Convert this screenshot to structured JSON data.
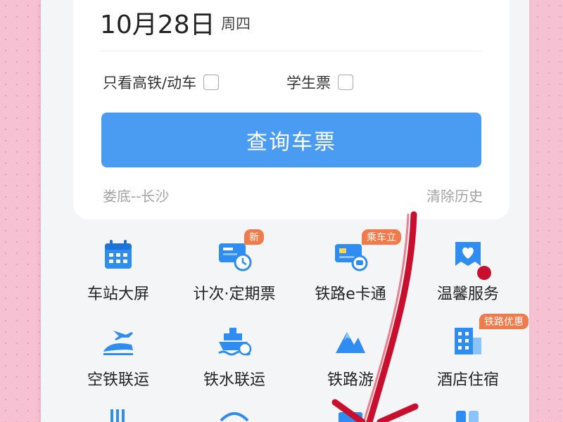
{
  "search": {
    "date": "10月28日",
    "weekday": "周四",
    "options": [
      {
        "label": "只看高铁/动车",
        "checked": false
      },
      {
        "label": "学生票",
        "checked": false
      }
    ],
    "query_button": "查询车票",
    "history": "娄底--长沙",
    "clear_history": "清除历史"
  },
  "services": [
    {
      "label": "车站大屏",
      "icon": "calendar-icon",
      "badge": ""
    },
    {
      "label": "计次·定期票",
      "icon": "ticket-clock-icon",
      "badge": "新"
    },
    {
      "label": "铁路e卡通",
      "icon": "ecard-icon",
      "badge": "乘车立"
    },
    {
      "label": "温馨服务",
      "icon": "heart-service-icon",
      "badge": ""
    },
    {
      "label": "空铁联运",
      "icon": "plane-train-icon",
      "badge": ""
    },
    {
      "label": "铁水联运",
      "icon": "ship-train-icon",
      "badge": ""
    },
    {
      "label": "铁路游",
      "icon": "mountain-icon",
      "badge": ""
    },
    {
      "label": "酒店住宿",
      "icon": "hotel-icon",
      "badge": "铁路优惠"
    }
  ],
  "colors": {
    "accent": "#4a9cf2",
    "icon_blue": "#2f8cf0",
    "badge": "#f07a4a",
    "annotation": "#c8102e"
  }
}
